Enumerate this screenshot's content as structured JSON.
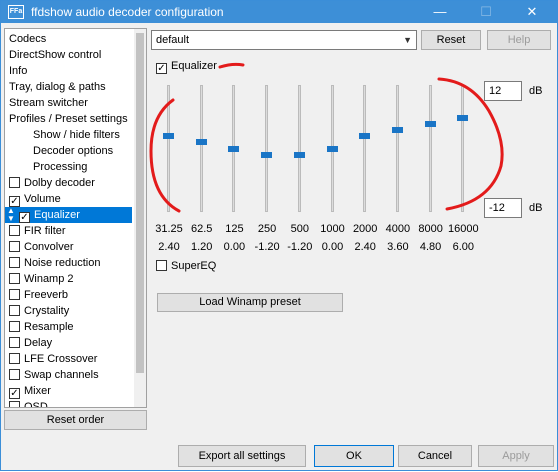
{
  "window": {
    "title": "ffdshow audio decoder configuration",
    "icon_text": "FFa"
  },
  "sidebar": {
    "items": [
      {
        "label": "Codecs",
        "sub": false,
        "checkbox": null
      },
      {
        "label": "DirectShow control",
        "sub": false,
        "checkbox": null
      },
      {
        "label": "Info",
        "sub": false,
        "checkbox": null
      },
      {
        "label": "Tray, dialog & paths",
        "sub": false,
        "checkbox": null
      },
      {
        "label": "Stream switcher",
        "sub": false,
        "checkbox": null
      },
      {
        "label": "Profiles / Preset settings",
        "sub": false,
        "checkbox": null
      },
      {
        "label": "Show / hide filters",
        "sub": true,
        "checkbox": null
      },
      {
        "label": "Decoder options",
        "sub": true,
        "checkbox": null
      },
      {
        "label": "Processing",
        "sub": true,
        "checkbox": null
      },
      {
        "label": "Dolby decoder",
        "sub": false,
        "checkbox": false
      },
      {
        "label": "Volume",
        "sub": false,
        "checkbox": true
      },
      {
        "label": "Equalizer",
        "sub": false,
        "checkbox": true,
        "selected": true
      },
      {
        "label": "FIR filter",
        "sub": false,
        "checkbox": false
      },
      {
        "label": "Convolver",
        "sub": false,
        "checkbox": false
      },
      {
        "label": "Noise reduction",
        "sub": false,
        "checkbox": false
      },
      {
        "label": "Winamp 2",
        "sub": false,
        "checkbox": false
      },
      {
        "label": "Freeverb",
        "sub": false,
        "checkbox": false
      },
      {
        "label": "Crystality",
        "sub": false,
        "checkbox": false
      },
      {
        "label": "Resample",
        "sub": false,
        "checkbox": false
      },
      {
        "label": "Delay",
        "sub": false,
        "checkbox": false
      },
      {
        "label": "LFE Crossover",
        "sub": false,
        "checkbox": false
      },
      {
        "label": "Swap channels",
        "sub": false,
        "checkbox": false
      },
      {
        "label": "Mixer",
        "sub": false,
        "checkbox": true
      },
      {
        "label": "OSD",
        "sub": false,
        "checkbox": false
      }
    ],
    "reset_order_label": "Reset order"
  },
  "preset": {
    "value": "default",
    "reset_label": "Reset",
    "help_label": "Help"
  },
  "equalizer": {
    "enabled_label": "Equalizer",
    "enabled": true,
    "max_db": "12",
    "min_db": "-12",
    "db_unit": "dB",
    "bands": [
      {
        "freq": "31.25",
        "gain": "2.40",
        "value": 2.4
      },
      {
        "freq": "62.5",
        "gain": "1.20",
        "value": 1.2
      },
      {
        "freq": "125",
        "gain": "0.00",
        "value": 0.0
      },
      {
        "freq": "250",
        "gain": "-1.20",
        "value": -1.2
      },
      {
        "freq": "500",
        "gain": "-1.20",
        "value": -1.2
      },
      {
        "freq": "1000",
        "gain": "0.00",
        "value": 0.0
      },
      {
        "freq": "2000",
        "gain": "2.40",
        "value": 2.4
      },
      {
        "freq": "4000",
        "gain": "3.60",
        "value": 3.6
      },
      {
        "freq": "8000",
        "gain": "4.80",
        "value": 4.8
      },
      {
        "freq": "16000",
        "gain": "6.00",
        "value": 6.0
      }
    ],
    "supereq_label": "SuperEQ",
    "supereq": false,
    "load_winamp_label": "Load Winamp preset"
  },
  "footer": {
    "export_label": "Export all settings",
    "ok_label": "OK",
    "cancel_label": "Cancel",
    "apply_label": "Apply"
  }
}
